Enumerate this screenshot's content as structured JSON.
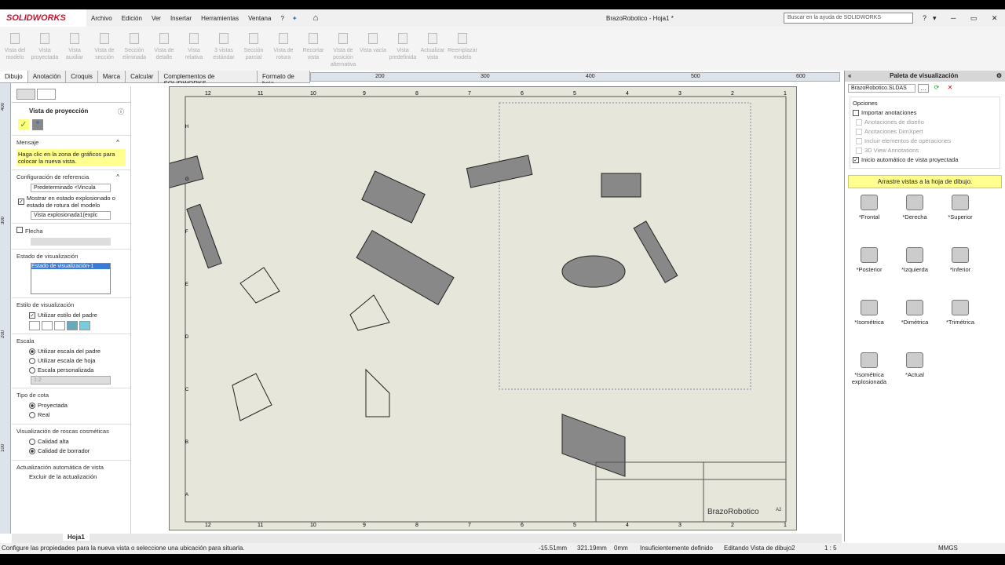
{
  "app": {
    "brand": "SOLIDWORKS",
    "title": "BrazoRobotico - Hoja1 *",
    "search_placeholder": "Buscar en la ayuda de SOLIDWORKS"
  },
  "menu": [
    "Archivo",
    "Edición",
    "Ver",
    "Insertar",
    "Herramientas",
    "Ventana",
    "?"
  ],
  "commands": [
    "Vista del modelo",
    "Vista proyectada",
    "Vista auxiliar",
    "Vista de sección",
    "Sección eliminada",
    "Vista de detalle",
    "Vista relativa",
    "3 vistas estándar",
    "Sección parcial",
    "Vista de rotura",
    "Recortar vista",
    "Vista de posición alternativa",
    "Vista vacía",
    "Vista predefinida",
    "Actualizar vista",
    "Reemplazar modelo"
  ],
  "tabs": [
    "Dibujo",
    "Anotación",
    "Croquis",
    "Marca",
    "Calcular",
    "Complementos de SOLIDWORKS",
    "Formato de hoja"
  ],
  "ruler_top": [
    "200",
    "300",
    "400",
    "500",
    "600"
  ],
  "ruler_left": [
    "400",
    "300",
    "200",
    "100"
  ],
  "pm": {
    "title": "Vista de proyección",
    "mensaje_h": "Mensaje",
    "mensaje": "Haga clic en la zona de gráficos para colocar la nueva vista.",
    "config_h": "Configuración de referencia",
    "config_val": "Predeterminado <Vincula",
    "explode_label": "Mostrar en estado explosionado o estado de rotura del modelo",
    "explode_val": "Vista explosionada1(explc",
    "flecha_h": "Flecha",
    "estado_h": "Estado de visualización",
    "estado_item": "Estado de visualización-1",
    "estilo_h": "Estilo de visualización",
    "estilo_padre": "Utilizar estilo del padre",
    "escala_h": "Escala",
    "escala_opts": [
      "Utilizar escala del padre",
      "Utilizar escala de hoja",
      "Escala personalizada"
    ],
    "escala_val": "1:2",
    "cota_h": "Tipo de cota",
    "cota_opts": [
      "Proyectada",
      "Real"
    ],
    "roscas_h": "Visualización de roscas cosméticas",
    "roscas_opts": [
      "Calidad alta",
      "Calidad de borrador"
    ],
    "actual_h": "Actualización automática de vista",
    "actual_sub": "Excluir de la actualización"
  },
  "sheet": {
    "title_block_name": "BrazoRobotico",
    "size": "A2",
    "cols": [
      "12",
      "11",
      "10",
      "9",
      "8",
      "7",
      "6",
      "5",
      "4",
      "3",
      "2",
      "1"
    ],
    "rows": [
      "H",
      "G",
      "F",
      "E",
      "D",
      "C",
      "B",
      "A"
    ]
  },
  "palette": {
    "title": "Paleta de visualización",
    "file": "BrazoRobotico.SLDAS",
    "opciones": "Opciones",
    "import": "Importar anotaciones",
    "sub": [
      "Anotaciones de diseño",
      "Anotaciones DimXpert",
      "Incluir elementos de operaciones",
      "3D View Annotations"
    ],
    "auto": "Inicio automático de vista proyectada",
    "drag": "Arrastre vistas a la hoja de dibujo.",
    "views": [
      "*Frontal",
      "*Derecha",
      "*Superior",
      "*Posterior",
      "*Izquierda",
      "*Inferior",
      "*Isométrica",
      "*Dimétrica",
      "*Trimétrica",
      "*Isométrica explosionada",
      "*Actual"
    ]
  },
  "sheet_tab": "Hoja1",
  "status": {
    "hint": "Configure las propiedades para la nueva vista o seleccione una ubicación para situarla.",
    "x": "-15.51mm",
    "y": "321.19mm",
    "z": "0mm",
    "def": "Insuficientemente definido",
    "edit": "Editando Vista de dibujo2",
    "scale": "1 : 5",
    "units": "MMGS"
  }
}
